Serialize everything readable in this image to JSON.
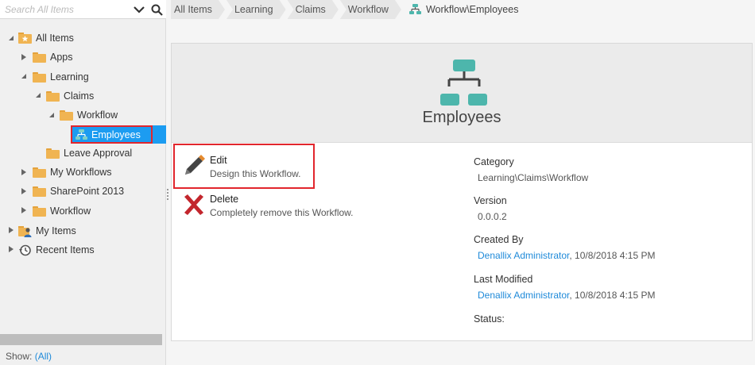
{
  "search": {
    "placeholder": "Search All Items"
  },
  "tree": {
    "all_items": "All Items",
    "apps": "Apps",
    "learning": "Learning",
    "claims": "Claims",
    "workflow": "Workflow",
    "employees": "Employees",
    "leave_approval": "Leave Approval",
    "my_workflows": "My Workflows",
    "sharepoint_2013": "SharePoint 2013",
    "workflow_root": "Workflow",
    "my_items": "My Items",
    "recent_items": "Recent Items"
  },
  "footer": {
    "show_label": "Show:",
    "show_value": "(All)"
  },
  "breadcrumbs": {
    "items": [
      "All Items",
      "Learning",
      "Claims",
      "Workflow"
    ],
    "current": "Workflow\\Employees"
  },
  "card": {
    "title": "Employees",
    "actions": {
      "edit": {
        "name": "Edit",
        "desc": "Design this Workflow."
      },
      "delete": {
        "name": "Delete",
        "desc": "Completely remove this Workflow."
      }
    },
    "properties": {
      "category_label": "Category",
      "category_value": "Learning\\Claims\\Workflow",
      "version_label": "Version",
      "version_value": "0.0.0.2",
      "created_by_label": "Created By",
      "created_by_user": "Denallix Administrator",
      "created_by_date": ", 10/8/2018 4:15 PM",
      "last_modified_label": "Last Modified",
      "last_modified_user": "Denallix Administrator",
      "last_modified_date": ", 10/8/2018 4:15 PM",
      "status_label": "Status:"
    }
  },
  "colors": {
    "accent": "#1c9cf1",
    "highlight_border": "#e2262d",
    "folder": "#f0b452",
    "workflow_icon": "#4db6ac",
    "link": "#1f8ad9"
  }
}
